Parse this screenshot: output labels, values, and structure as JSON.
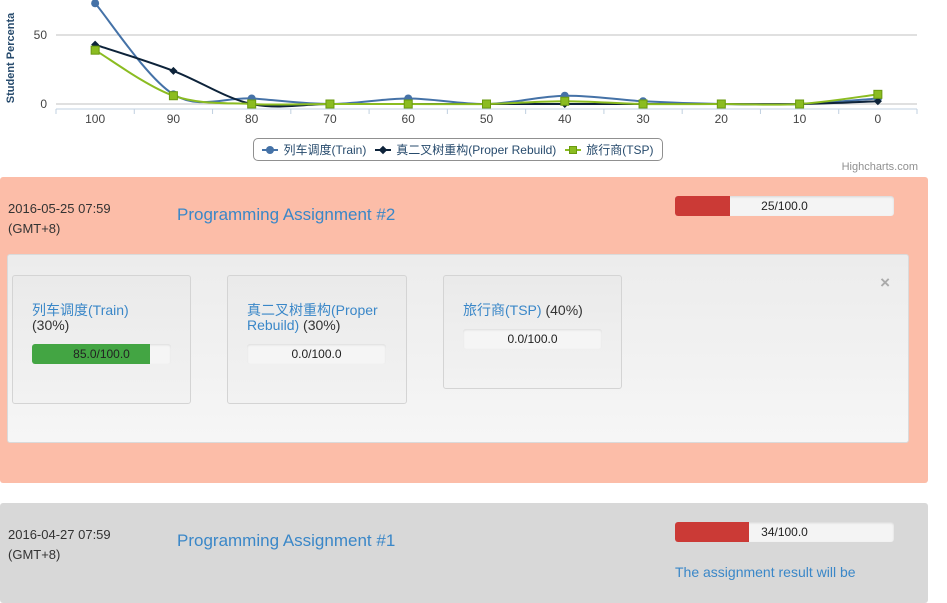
{
  "chart_data": {
    "type": "line",
    "ylabel": "Student Percenta",
    "x": [
      "100",
      "90",
      "80",
      "70",
      "60",
      "50",
      "40",
      "30",
      "20",
      "10",
      "0"
    ],
    "y_ticks": [
      "0",
      "50"
    ],
    "ylim": [
      0,
      75
    ],
    "grid": "horizontal",
    "legend_position": "bottom-center",
    "series": [
      {
        "name": "列车调度(Train)",
        "color": "#4572a7",
        "marker": "circle",
        "values": [
          73,
          7,
          4,
          0,
          4,
          0,
          6,
          2,
          0,
          0,
          4
        ]
      },
      {
        "name": "真二叉树重构(Proper Rebuild)",
        "color": "#0d233a",
        "marker": "diamond",
        "values": [
          43,
          24,
          0,
          0,
          0,
          0,
          0,
          0,
          0,
          0,
          2
        ]
      },
      {
        "name": "旅行商(TSP)",
        "color": "#8bbc21",
        "marker": "square",
        "values": [
          39,
          6,
          0,
          0,
          0,
          0,
          2,
          0,
          0,
          0,
          7
        ]
      }
    ],
    "credits": "Highcharts.com"
  },
  "assignments": [
    {
      "date": "2016-05-25 07:59",
      "tz": "(GMT+8)",
      "title": "Programming Assignment #2",
      "progress_label": "25/100.0",
      "progress_fraction": 0.25,
      "problems": [
        {
          "name": "列车调度(Train)",
          "weight": "(30%)",
          "score_label": "85.0/100.0",
          "fraction": 0.85
        },
        {
          "name": "真二叉树重构(Proper Rebuild)",
          "weight": "(30%)",
          "score_label": "0.0/100.0",
          "fraction": 0
        },
        {
          "name": "旅行商(TSP)",
          "weight": "(40%)",
          "score_label": "0.0/100.0",
          "fraction": 0
        }
      ],
      "close_label": "×"
    },
    {
      "date": "2016-04-27 07:59",
      "tz": "(GMT+8)",
      "title": "Programming Assignment #1",
      "progress_label": "34/100.0",
      "progress_fraction": 0.34,
      "note": "The assignment result will be"
    }
  ]
}
